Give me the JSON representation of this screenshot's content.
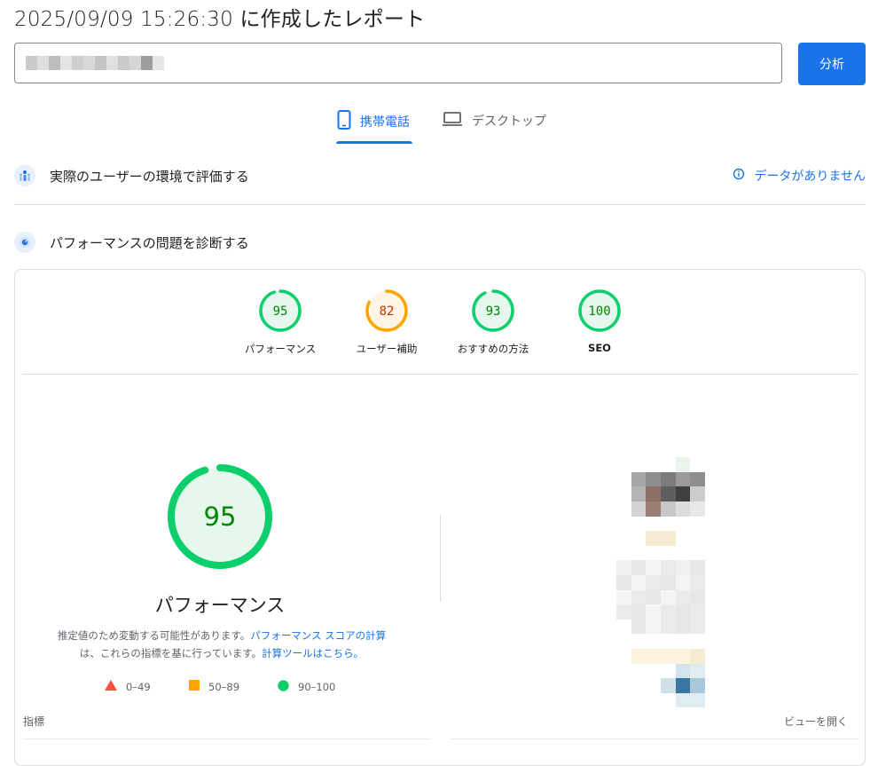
{
  "header": {
    "title": "2025/09/09 15:26:30 に作成したレポート"
  },
  "url_input": {
    "value": ""
  },
  "analyze_button": {
    "label": "分析"
  },
  "tabs": [
    {
      "label": "携帯電話",
      "icon": "mobile-phone-icon",
      "active": true
    },
    {
      "label": "デスクトップ",
      "icon": "laptop-icon",
      "active": false
    }
  ],
  "field_data": {
    "title": "実際のユーザーの環境で評価する",
    "status": "データがありません",
    "icon": "users-icon",
    "status_icon": "info-icon"
  },
  "lab_data": {
    "title": "パフォーマンスの問題を診断する",
    "icon": "diagnose-icon"
  },
  "scores": [
    {
      "value": "95",
      "label": "パフォーマンス",
      "color": "#0cce6b",
      "text_color": "#008800"
    },
    {
      "value": "82",
      "label": "ユーザー補助",
      "color": "#ffa400",
      "text_color": "#c33300"
    },
    {
      "value": "93",
      "label": "おすすめの方法",
      "color": "#0cce6b",
      "text_color": "#008800"
    },
    {
      "value": "100",
      "label": "SEO",
      "color": "#0cce6b",
      "text_color": "#008800"
    }
  ],
  "performance": {
    "score": "95",
    "title": "パフォーマンス",
    "desc_1": "推定値のため変動する可能性があります。",
    "link_1": "パフォーマンス スコアの計算",
    "desc_2": "は、これらの指標を基に行っています。",
    "link_2": "計算ツールはこちら。"
  },
  "legend": [
    {
      "range": "0–49",
      "shape": "triangle",
      "color": "#ff4e42"
    },
    {
      "range": "50–89",
      "shape": "square",
      "color": "#ffa400"
    },
    {
      "range": "90–100",
      "shape": "circle",
      "color": "#0cce6b"
    }
  ],
  "metrics": {
    "label": "指標",
    "view_toggle": "ビューを開く"
  },
  "colors": {
    "accent": "#1a73e8",
    "pass": "#0cce6b",
    "average": "#ffa400",
    "fail": "#ff4e42"
  }
}
